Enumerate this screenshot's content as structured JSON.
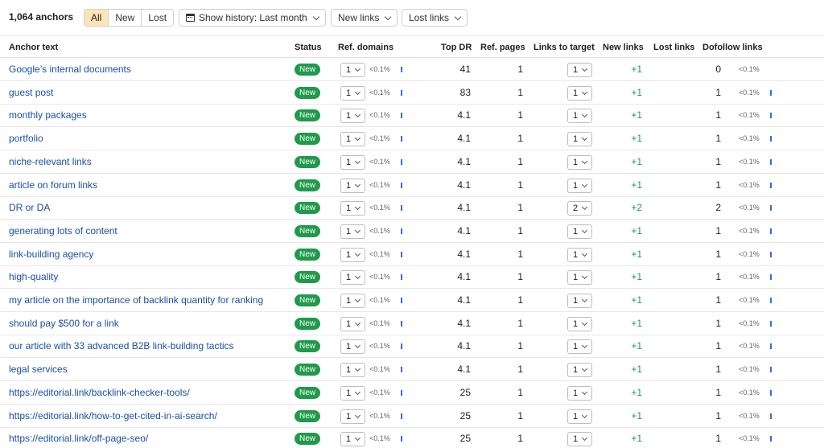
{
  "toolbar": {
    "count": "1,064 anchors",
    "filters": [
      "All",
      "New",
      "Lost"
    ],
    "active_filter": "All",
    "history": "Show history: Last month",
    "new_links": "New links",
    "lost_links": "Lost links"
  },
  "columns": {
    "anchor_text": "Anchor text",
    "status": "Status",
    "ref_domains": "Ref. domains",
    "top_dr": "Top DR",
    "ref_pages": "Ref. pages",
    "links_to_target": "Links to target",
    "new_links": "New links",
    "lost_links": "Lost links",
    "dofollow_links": "Dofollow links"
  },
  "rows": [
    {
      "anchor": "Google’s internal documents",
      "status": "New",
      "ref_domains": "1",
      "ref_domains_pct": "<0.1%",
      "top_dr": "41",
      "ref_pages": "1",
      "links_to_target": "1",
      "new_links": "+1",
      "lost_links": "",
      "dofollow": "0",
      "dofollow_pct": "<0.1%"
    },
    {
      "anchor": "guest post",
      "status": "New",
      "ref_domains": "1",
      "ref_domains_pct": "<0.1%",
      "top_dr": "83",
      "ref_pages": "1",
      "links_to_target": "1",
      "new_links": "+1",
      "lost_links": "",
      "dofollow": "1",
      "dofollow_pct": "<0.1%"
    },
    {
      "anchor": "monthly packages",
      "status": "New",
      "ref_domains": "1",
      "ref_domains_pct": "<0.1%",
      "top_dr": "4.1",
      "ref_pages": "1",
      "links_to_target": "1",
      "new_links": "+1",
      "lost_links": "",
      "dofollow": "1",
      "dofollow_pct": "<0.1%"
    },
    {
      "anchor": "portfolio",
      "status": "New",
      "ref_domains": "1",
      "ref_domains_pct": "<0.1%",
      "top_dr": "4.1",
      "ref_pages": "1",
      "links_to_target": "1",
      "new_links": "+1",
      "lost_links": "",
      "dofollow": "1",
      "dofollow_pct": "<0.1%"
    },
    {
      "anchor": "niche-relevant links",
      "status": "New",
      "ref_domains": "1",
      "ref_domains_pct": "<0.1%",
      "top_dr": "4.1",
      "ref_pages": "1",
      "links_to_target": "1",
      "new_links": "+1",
      "lost_links": "",
      "dofollow": "1",
      "dofollow_pct": "<0.1%"
    },
    {
      "anchor": "article on forum links",
      "status": "New",
      "ref_domains": "1",
      "ref_domains_pct": "<0.1%",
      "top_dr": "4.1",
      "ref_pages": "1",
      "links_to_target": "1",
      "new_links": "+1",
      "lost_links": "",
      "dofollow": "1",
      "dofollow_pct": "<0.1%"
    },
    {
      "anchor": "DR or DA",
      "status": "New",
      "ref_domains": "1",
      "ref_domains_pct": "<0.1%",
      "top_dr": "4.1",
      "ref_pages": "1",
      "links_to_target": "2",
      "new_links": "+2",
      "lost_links": "",
      "dofollow": "2",
      "dofollow_pct": "<0.1%"
    },
    {
      "anchor": "generating lots of content",
      "status": "New",
      "ref_domains": "1",
      "ref_domains_pct": "<0.1%",
      "top_dr": "4.1",
      "ref_pages": "1",
      "links_to_target": "1",
      "new_links": "+1",
      "lost_links": "",
      "dofollow": "1",
      "dofollow_pct": "<0.1%"
    },
    {
      "anchor": "link-building agency",
      "status": "New",
      "ref_domains": "1",
      "ref_domains_pct": "<0.1%",
      "top_dr": "4.1",
      "ref_pages": "1",
      "links_to_target": "1",
      "new_links": "+1",
      "lost_links": "",
      "dofollow": "1",
      "dofollow_pct": "<0.1%"
    },
    {
      "anchor": "high-quality",
      "status": "New",
      "ref_domains": "1",
      "ref_domains_pct": "<0.1%",
      "top_dr": "4.1",
      "ref_pages": "1",
      "links_to_target": "1",
      "new_links": "+1",
      "lost_links": "",
      "dofollow": "1",
      "dofollow_pct": "<0.1%"
    },
    {
      "anchor": "my article on the importance of backlink quantity for ranking",
      "status": "New",
      "ref_domains": "1",
      "ref_domains_pct": "<0.1%",
      "top_dr": "4.1",
      "ref_pages": "1",
      "links_to_target": "1",
      "new_links": "+1",
      "lost_links": "",
      "dofollow": "1",
      "dofollow_pct": "<0.1%"
    },
    {
      "anchor": "should pay $500 for a link",
      "status": "New",
      "ref_domains": "1",
      "ref_domains_pct": "<0.1%",
      "top_dr": "4.1",
      "ref_pages": "1",
      "links_to_target": "1",
      "new_links": "+1",
      "lost_links": "",
      "dofollow": "1",
      "dofollow_pct": "<0.1%"
    },
    {
      "anchor": "our article with 33 advanced B2B link-building tactics",
      "status": "New",
      "ref_domains": "1",
      "ref_domains_pct": "<0.1%",
      "top_dr": "4.1",
      "ref_pages": "1",
      "links_to_target": "1",
      "new_links": "+1",
      "lost_links": "",
      "dofollow": "1",
      "dofollow_pct": "<0.1%"
    },
    {
      "anchor": "legal services",
      "status": "New",
      "ref_domains": "1",
      "ref_domains_pct": "<0.1%",
      "top_dr": "4.1",
      "ref_pages": "1",
      "links_to_target": "1",
      "new_links": "+1",
      "lost_links": "",
      "dofollow": "1",
      "dofollow_pct": "<0.1%"
    },
    {
      "anchor": "https://editorial.link/backlink-checker-tools/",
      "status": "New",
      "ref_domains": "1",
      "ref_domains_pct": "<0.1%",
      "top_dr": "25",
      "ref_pages": "1",
      "links_to_target": "1",
      "new_links": "+1",
      "lost_links": "",
      "dofollow": "1",
      "dofollow_pct": "<0.1%"
    },
    {
      "anchor": "https://editorial.link/how-to-get-cited-in-ai-search/",
      "status": "New",
      "ref_domains": "1",
      "ref_domains_pct": "<0.1%",
      "top_dr": "25",
      "ref_pages": "1",
      "links_to_target": "1",
      "new_links": "+1",
      "lost_links": "",
      "dofollow": "1",
      "dofollow_pct": "<0.1%"
    },
    {
      "anchor": "https://editorial.link/off-page-seo/",
      "status": "New",
      "ref_domains": "1",
      "ref_domains_pct": "<0.1%",
      "top_dr": "25",
      "ref_pages": "1",
      "links_to_target": "1",
      "new_links": "+1",
      "lost_links": "",
      "dofollow": "1",
      "dofollow_pct": "<0.1%"
    }
  ]
}
